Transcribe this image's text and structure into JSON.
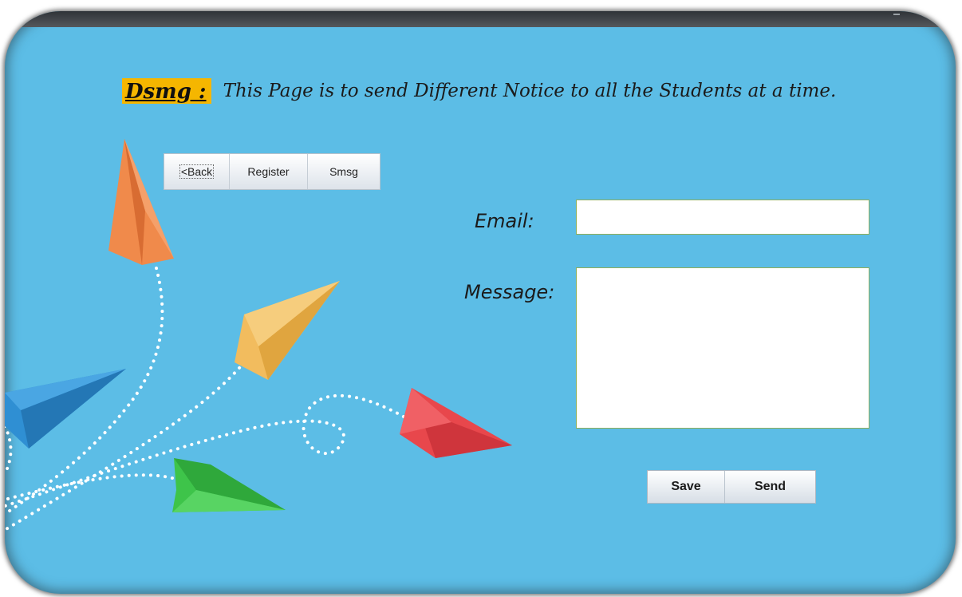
{
  "header": {
    "tag": "Dsmg :",
    "description": "This Page is to send Different Notice to all the Students at a time."
  },
  "nav": {
    "back_label": "<Back",
    "register_label": "Register",
    "smsg_label": "Smsg"
  },
  "form": {
    "email_label": "Email:",
    "email_value": "",
    "message_label": "Message:",
    "message_value": ""
  },
  "actions": {
    "save_label": "Save",
    "send_label": "Send"
  },
  "colors": {
    "background": "#5cbde6",
    "tag_highlight": "#f5b600",
    "plane_orange": "#f08a4b",
    "plane_yellow": "#f2bc5e",
    "plane_blue": "#2f8fd3",
    "plane_red": "#e8474c",
    "plane_green": "#3ec44a"
  },
  "decorations": {
    "planes": [
      "orange-paper-plane",
      "yellow-paper-plane",
      "blue-paper-plane",
      "red-paper-plane",
      "green-paper-plane"
    ]
  }
}
